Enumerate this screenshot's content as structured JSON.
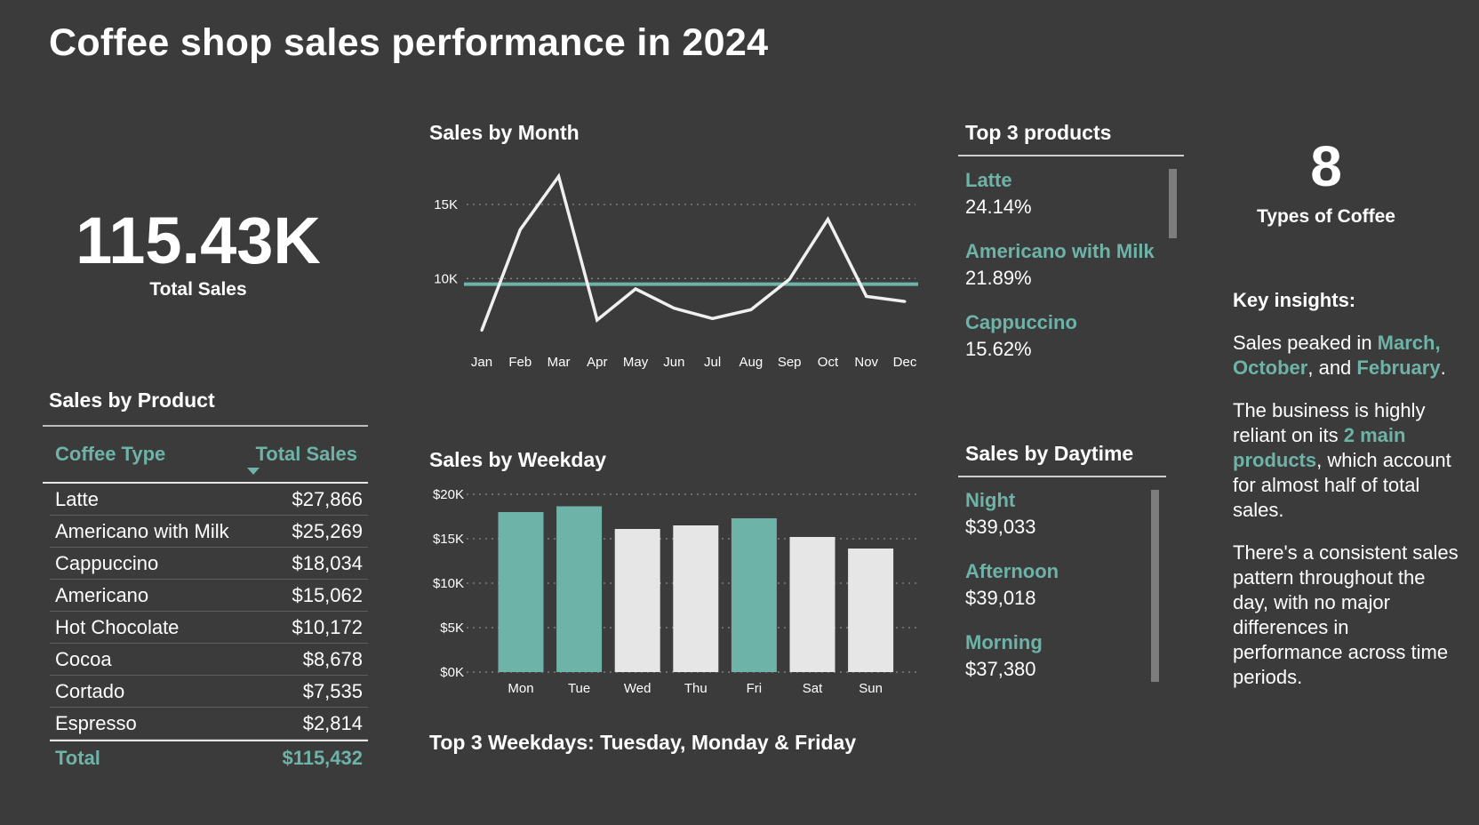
{
  "title": "Coffee shop sales performance in 2024",
  "kpis": {
    "total_sales_value": "115.43K",
    "total_sales_label": "Total Sales",
    "coffee_types_value": "8",
    "coffee_types_label": "Types of Coffee"
  },
  "product_table": {
    "title": "Sales by Product",
    "col1": "Coffee Type",
    "col2": "Total Sales",
    "rows": [
      {
        "name": "Latte",
        "sales": "$27,866"
      },
      {
        "name": "Americano with Milk",
        "sales": "$25,269"
      },
      {
        "name": "Cappuccino",
        "sales": "$18,034"
      },
      {
        "name": "Americano",
        "sales": "$15,062"
      },
      {
        "name": "Hot Chocolate",
        "sales": "$10,172"
      },
      {
        "name": "Cocoa",
        "sales": "$8,678"
      },
      {
        "name": "Cortado",
        "sales": "$7,535"
      },
      {
        "name": "Espresso",
        "sales": "$2,814"
      }
    ],
    "total_label": "Total",
    "total_value": "$115,432"
  },
  "top_products": {
    "title": "Top 3 products",
    "items": [
      {
        "name": "Latte",
        "value": "24.14%"
      },
      {
        "name": "Americano with Milk",
        "value": "21.89%"
      },
      {
        "name": "Cappuccino",
        "value": "15.62%"
      }
    ]
  },
  "daytime": {
    "title": "Sales by Daytime",
    "items": [
      {
        "name": "Night",
        "value": "$39,033"
      },
      {
        "name": "Afternoon",
        "value": "$39,018"
      },
      {
        "name": "Morning",
        "value": "$37,380"
      }
    ]
  },
  "weekday_caption": "Top 3 Weekdays: Tuesday, Monday & Friday",
  "insights": {
    "title": "Key insights:",
    "p1_a": "Sales peaked in ",
    "p1_b": "March, October",
    "p1_c": ", and ",
    "p1_d": "February",
    "p1_e": ".",
    "p2_a": "The business is highly reliant on its ",
    "p2_b": "2 main products",
    "p2_c": ", which account for almost half of total sales.",
    "p3": "There's a consistent sales pattern throughout the day, with no major differences in performance across time periods."
  },
  "colors": {
    "background": "#3b3b3b",
    "accent": "#6db3a7",
    "light_bar": "#e6e6e6",
    "line": "#f0f0f0"
  },
  "chart_data": [
    {
      "type": "line",
      "title": "Sales by Month",
      "categories": [
        "Jan",
        "Feb",
        "Mar",
        "Apr",
        "May",
        "Jun",
        "Jul",
        "Aug",
        "Sep",
        "Oct",
        "Nov",
        "Dec"
      ],
      "values": [
        6500,
        13300,
        16900,
        7200,
        9300,
        8000,
        7300,
        7900,
        9950,
        14000,
        8800,
        8450
      ],
      "reference_line": 9620,
      "yticks": [
        10000,
        15000
      ],
      "ytick_labels": [
        "10K",
        "15K"
      ],
      "ylim": [
        6000,
        18000
      ],
      "grid": "dotted"
    },
    {
      "type": "bar",
      "title": "Sales by Weekday",
      "categories": [
        "Mon",
        "Tue",
        "Wed",
        "Thu",
        "Fri",
        "Sat",
        "Sun"
      ],
      "values": [
        18000,
        18650,
        16100,
        16500,
        17300,
        15200,
        13900
      ],
      "highlighted": [
        true,
        true,
        false,
        false,
        true,
        false,
        false
      ],
      "yticks": [
        0,
        5000,
        10000,
        15000,
        20000
      ],
      "ytick_labels": [
        "$0K",
        "$5K",
        "$10K",
        "$15K",
        "$20K"
      ],
      "ylim": [
        0,
        20000
      ],
      "grid": "dotted"
    }
  ]
}
